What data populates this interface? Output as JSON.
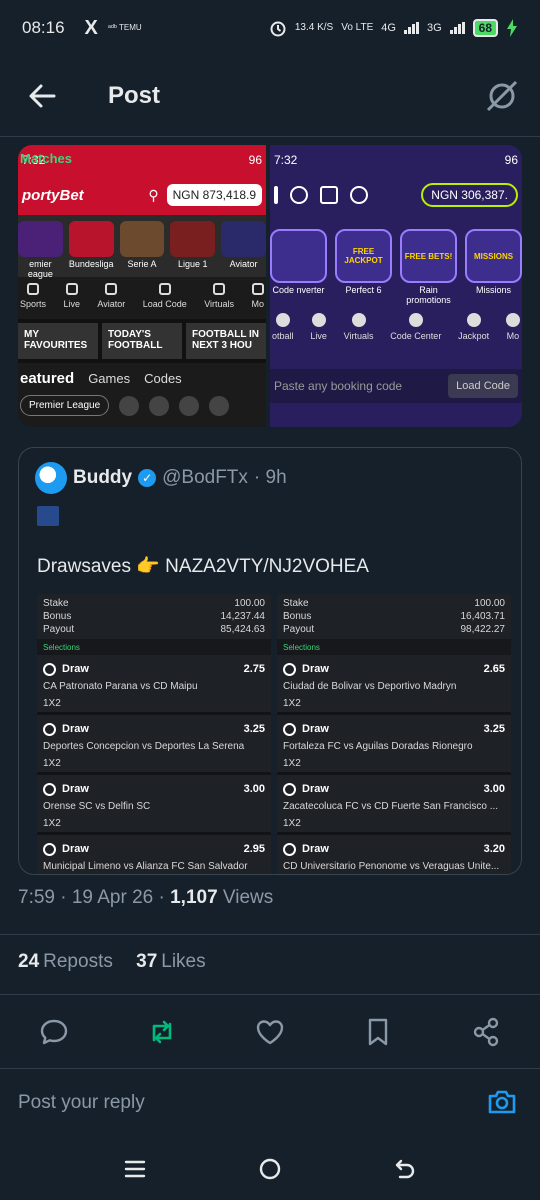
{
  "status": {
    "time": "08:16",
    "x_app": "X",
    "temu": "ᵃᵈᵇ TEMU",
    "speed": "13.4 K/S",
    "network": "Vo LTE",
    "net4g": "4G",
    "net3g": "3G",
    "battery": "68"
  },
  "header": {
    "title": "Post"
  },
  "images": {
    "left": {
      "time": "7:32",
      "app_logo": "portyBet",
      "balance": "NGN 873,418.9",
      "leagues": [
        "emier eague",
        "Bundesliga",
        "Serie A",
        "Ligue 1",
        "Aviator"
      ],
      "quick": [
        "Sports",
        "Live",
        "Aviator",
        "Load Code",
        "Virtuals",
        "Mo"
      ],
      "tabs": [
        "MY FAVOURITES",
        "TODAY'S FOOTBALL",
        "FOOTBALL IN NEXT 3 HOU"
      ],
      "filters": [
        "eatured",
        "Matches",
        "Games",
        "Codes"
      ],
      "pill": "Premier League"
    },
    "right": {
      "time": "7:32",
      "balance": "NGN 306,387.",
      "promos": [
        "Code nverter",
        "Perfect 6",
        "Rain promotions",
        "Missions"
      ],
      "promo_badges": [
        "",
        "FREE JACKPOT",
        "FREE BETS!",
        "MISSIONS"
      ],
      "quick": [
        "otball",
        "Live",
        "Virtuals",
        "Code Center",
        "Jackpot",
        "Mo"
      ],
      "booking_placeholder": "Paste any booking code",
      "load_code": "Load Code"
    }
  },
  "quote": {
    "name": "Buddy",
    "handle": "@BodFTx",
    "time": "· 9h",
    "text": "Drawsaves 👉 NAZA2VTY/NJ2VOHEA",
    "slips": [
      {
        "stake_label": "Stake",
        "stake": "100.00",
        "bonus_label": "Bonus",
        "bonus": "14,237.44",
        "payout_label": "Payout",
        "payout": "85,424.63",
        "selections_label": "Selections",
        "picks": [
          {
            "pick": "Draw",
            "odds": "2.75",
            "match": "CA Patronato Parana vs CD Maipu",
            "market": "1X2"
          },
          {
            "pick": "Draw",
            "odds": "3.25",
            "match": "Deportes Concepcion vs Deportes La Serena",
            "market": "1X2"
          },
          {
            "pick": "Draw",
            "odds": "3.00",
            "match": "Orense SC vs Delfin SC",
            "market": "1X2"
          },
          {
            "pick": "Draw",
            "odds": "2.95",
            "match": "Municipal Limeno vs Alianza FC San Salvador",
            "market": ""
          }
        ]
      },
      {
        "stake_label": "Stake",
        "stake": "100.00",
        "bonus_label": "Bonus",
        "bonus": "16,403.71",
        "payout_label": "Payout",
        "payout": "98,422.27",
        "selections_label": "Selections",
        "picks": [
          {
            "pick": "Draw",
            "odds": "2.65",
            "match": "Ciudad de Bolivar vs Deportivo Madryn",
            "market": "1X2"
          },
          {
            "pick": "Draw",
            "odds": "3.25",
            "match": "Fortaleza FC vs Aguilas Doradas Rionegro",
            "market": "1X2"
          },
          {
            "pick": "Draw",
            "odds": "3.00",
            "match": "Zacatecoluca FC vs CD Fuerte San Francisco ...",
            "market": "1X2"
          },
          {
            "pick": "Draw",
            "odds": "3.20",
            "match": "CD Universitario Penonome vs Veraguas Unite...",
            "market": ""
          }
        ]
      }
    ]
  },
  "meta": {
    "time_date": "7:59 · 19 Apr 26 · ",
    "views_count": "1,107",
    "views_label": " Views"
  },
  "stats": {
    "reposts_count": "24",
    "reposts_label": "Reposts",
    "likes_count": "37",
    "likes_label": "Likes"
  },
  "reply": {
    "placeholder": "Post your reply"
  },
  "colors": {
    "background": "#15202b",
    "accent": "#1d9bf0",
    "repost_active": "#00ba7c",
    "muted": "#8b98a5"
  }
}
